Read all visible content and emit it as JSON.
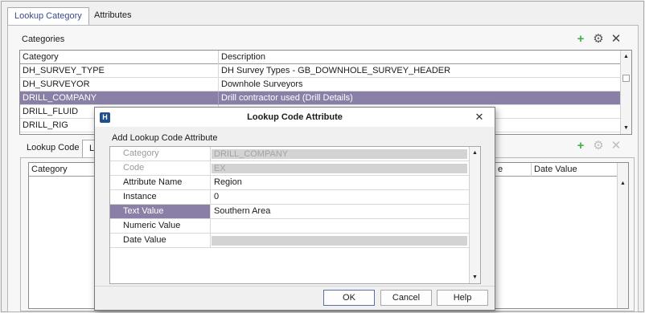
{
  "top_tabs": [
    {
      "label": "Lookup Category",
      "active": true
    },
    {
      "label": "Attributes",
      "active": false
    }
  ],
  "categories_section": {
    "title": "Categories",
    "icons": {
      "add": "plus-icon",
      "settings": "gear-icon",
      "close": "close-icon"
    },
    "columns": [
      "Category",
      "Description"
    ],
    "rows": [
      {
        "category": "DH_SURVEY_TYPE",
        "description": "DH Survey Types - GB_DOWNHOLE_SURVEY_HEADER",
        "selected": false
      },
      {
        "category": "DH_SURVEYOR",
        "description": "Downhole Surveyors",
        "selected": false
      },
      {
        "category": "DRILL_COMPANY",
        "description": "Drill contractor used (Drill Details)",
        "selected": true
      },
      {
        "category": "DRILL_FLUID",
        "description": "",
        "selected": false
      },
      {
        "category": "DRILL_RIG",
        "description": "",
        "selected": false
      }
    ]
  },
  "lower_tabs": [
    {
      "label": "Lookup Code",
      "active": false
    },
    {
      "label": "Lo",
      "active": true
    }
  ],
  "lower_grid": {
    "columns": [
      "Category",
      "e",
      "Date Value"
    ]
  },
  "dialog": {
    "title": "Lookup Code Attribute",
    "app_icon": "H",
    "section_label": "Add Lookup Code Attribute",
    "properties": [
      {
        "label": "Category",
        "value": "DRILL_COMPANY",
        "disabled": true,
        "selected": false
      },
      {
        "label": "Code",
        "value": "EX",
        "disabled": true,
        "selected": false
      },
      {
        "label": "Attribute Name",
        "value": "Region",
        "disabled": false,
        "selected": false
      },
      {
        "label": "Instance",
        "value": "0",
        "disabled": false,
        "selected": false
      },
      {
        "label": "Text Value",
        "value": "Southern Area",
        "disabled": false,
        "selected": true
      },
      {
        "label": "Numeric Value",
        "value": "",
        "disabled": false,
        "selected": false
      },
      {
        "label": "Date Value",
        "value": "",
        "disabled": true,
        "selected": false
      }
    ],
    "buttons": {
      "ok": "OK",
      "cancel": "Cancel",
      "help": "Help"
    }
  },
  "colors": {
    "selection": "#8a7fa6",
    "add_icon": "#3bb34a",
    "tab_text": "#3a4a8a"
  }
}
